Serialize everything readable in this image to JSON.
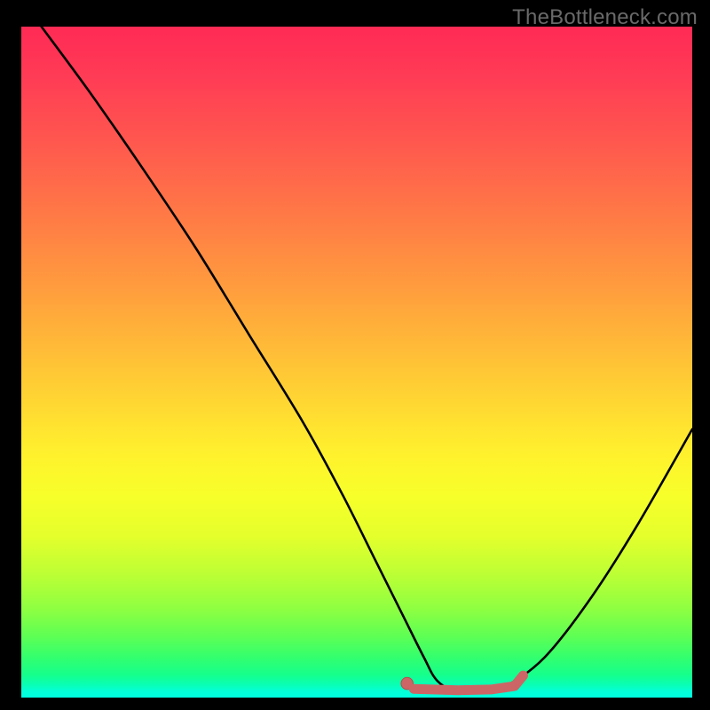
{
  "watermark": "TheBottleneck.com",
  "colors": {
    "page_background": "#000000",
    "gradient_top": "#ff2a55",
    "gradient_bottom": "#00ffe0",
    "curve_stroke": "#000000",
    "marker_fill": "#cc6666",
    "marker_stroke": "#b84d4d"
  },
  "chart_data": {
    "type": "line",
    "title": "",
    "xlabel": "",
    "ylabel": "",
    "xlim": [
      0,
      100
    ],
    "ylim": [
      0,
      100
    ],
    "grid": false,
    "legend": false,
    "series": [
      {
        "name": "bottleneck-curve",
        "x": [
          3,
          10,
          18,
          26,
          34,
          42,
          48,
          53,
          57,
          60,
          62,
          65,
          68,
          72,
          78,
          85,
          92,
          100
        ],
        "y": [
          100,
          90.5,
          79,
          67,
          54,
          41,
          30,
          20,
          12,
          6,
          2.5,
          0.8,
          0.8,
          1.6,
          6,
          15,
          26,
          40
        ]
      }
    ],
    "markers": [
      {
        "name": "optimum-start-dot",
        "shape": "circle",
        "x": 57.5,
        "y": 2.1,
        "r": 0.9
      },
      {
        "name": "optimum-range-bar",
        "shape": "path",
        "points_x": [
          58.5,
          65,
          70,
          73.5,
          74.8
        ],
        "points_y": [
          1.3,
          1.1,
          1.2,
          1.7,
          3.3
        ]
      }
    ]
  }
}
